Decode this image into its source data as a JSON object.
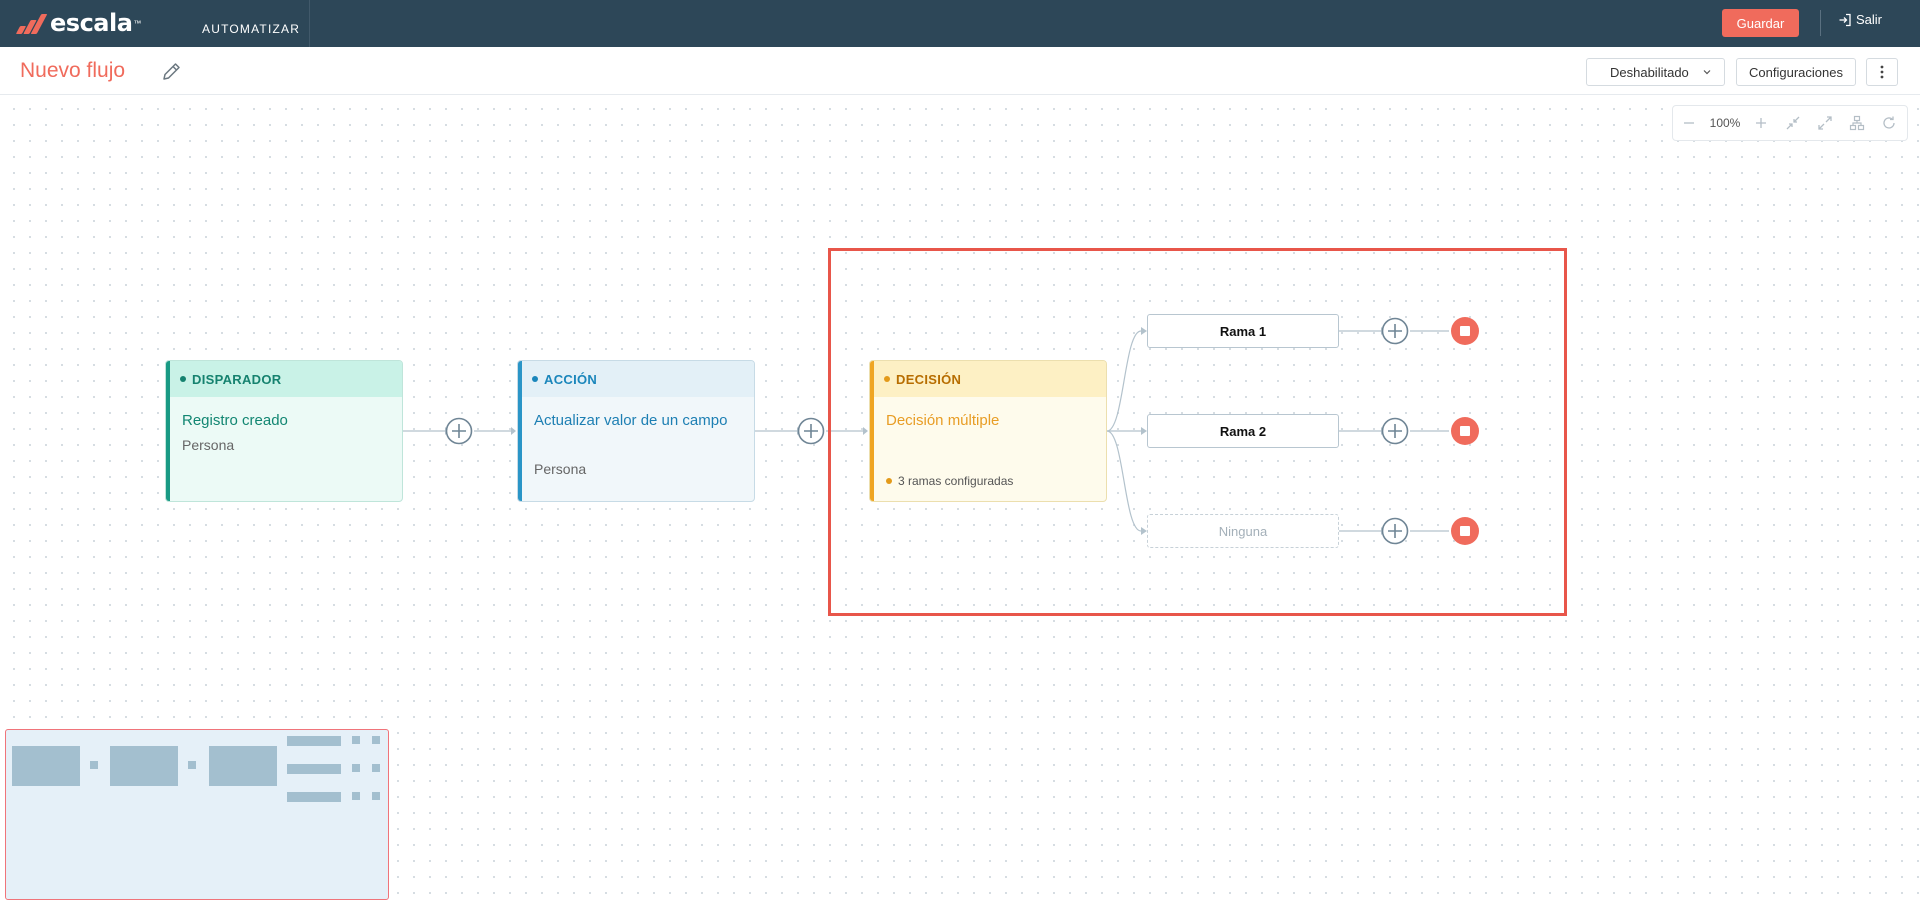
{
  "topbar": {
    "logo_text": "escala",
    "logo_tm": "™",
    "module": "AUTOMATIZAR",
    "save_label": "Guardar",
    "exit_label": "Salir"
  },
  "header": {
    "title": "Nuevo flujo",
    "status_select": "Deshabilitado",
    "settings_label": "Configuraciones"
  },
  "zoom": {
    "level": "100%"
  },
  "nodes": {
    "trigger": {
      "type": "DISPARADOR",
      "title": "Registro creado",
      "subtitle": "Persona"
    },
    "action": {
      "type": "ACCIÓN",
      "title": "Actualizar valor de un campo",
      "subtitle": "Persona"
    },
    "decision": {
      "type": "DECISIÓN",
      "title": "Decisión múltiple",
      "meta": "3 ramas configuradas"
    }
  },
  "branches": [
    {
      "label": "Rama 1"
    },
    {
      "label": "Rama 2"
    },
    {
      "label": "Ninguna"
    }
  ],
  "colors": {
    "brand": "#f06b5c",
    "topbar": "#2d4758",
    "trigger": "#199a84",
    "action": "#2a95c7",
    "decision": "#efa523",
    "selection": "#e8564a"
  },
  "icons": [
    "logo-icon",
    "exit-icon",
    "edit-icon",
    "chevron-down-icon",
    "more-vertical-icon",
    "zoom-out-icon",
    "zoom-in-icon",
    "collapse-icon",
    "expand-icon",
    "layout-icon",
    "refresh-icon",
    "add-step-icon",
    "end-flow-icon"
  ]
}
